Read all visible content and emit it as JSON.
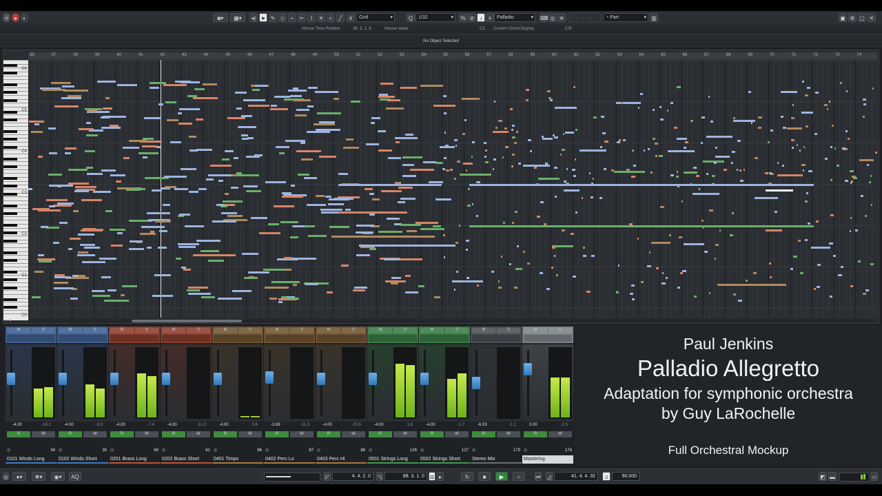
{
  "toolbar": {
    "grid_type": "Grid",
    "quantize": "1/32",
    "chord_track": "Palladio",
    "articulation": "Part"
  },
  "infobar": {
    "mouse_time_label": "Mouse Time Position",
    "mouse_time_value": "38. 3. 1. 8",
    "mouse_value_label": "Mouse Value",
    "mouse_value_value": "C2",
    "chord_label": "Current Chord Display",
    "chord_value": "C/E"
  },
  "status": "No Object Selected",
  "ruler": [
    "36",
    "37",
    "38",
    "39",
    "40",
    "41",
    "42",
    "43",
    "44",
    "45",
    "46",
    "47",
    "48",
    "49",
    "50",
    "51",
    "52",
    "53",
    "54",
    "55",
    "56",
    "57",
    "58",
    "59",
    "60",
    "61",
    "62",
    "63",
    "64",
    "65",
    "66",
    "67",
    "68",
    "69",
    "70",
    "71",
    "72",
    "73",
    "74"
  ],
  "keyboard_labels": [
    "C6",
    "C5",
    "C4",
    "C3",
    "C2",
    "C1",
    "C0"
  ],
  "colors": {
    "note_blue": "#9db5e0",
    "note_green": "#6bb06a",
    "note_orange": "#d98568",
    "note_brown": "#b08a5e",
    "note_white": "#f2f2f2",
    "meter": "#8cc63f",
    "fader": "#4a9ad8"
  },
  "mixer": [
    {
      "name": "0101 Winds Long",
      "num": "34",
      "vol": "-4.00",
      "peak": "-10.1",
      "color": "#3f5f8f",
      "bar": "#3e7ac4",
      "m1": 40,
      "m2": 42,
      "fader": 0.62
    },
    {
      "name": "0102 Winds Short",
      "num": "35",
      "vol": "-4.00",
      "peak": "-3.9",
      "color": "#3f5f8f",
      "bar": "#3e7ac4",
      "m1": 46,
      "m2": 40,
      "fader": 0.62
    },
    {
      "name": "0201 Brass Long",
      "num": "60",
      "vol": "-4.00",
      "peak": "-7.4",
      "color": "#8a3f2f",
      "bar": "#c0532f",
      "m1": 62,
      "m2": 58,
      "fader": 0.62
    },
    {
      "name": "0202 Brass Short",
      "num": "61",
      "vol": "-4.00",
      "peak": "-11.0",
      "color": "#8a3f2f",
      "bar": "#c0532f",
      "m1": 0,
      "m2": 0,
      "fader": 0.62
    },
    {
      "name": "0401 Timps",
      "num": "86",
      "vol": "-4.00",
      "peak": "0.8",
      "color": "#6f5433",
      "bar": "#a77b3e",
      "m1": 2,
      "m2": 2,
      "fader": 0.62
    },
    {
      "name": "0402 Perc Lo",
      "num": "87",
      "vol": "-3.69",
      "peak": "-11.3",
      "color": "#6f5433",
      "bar": "#a77b3e",
      "m1": 0,
      "m2": 0,
      "fader": 0.64
    },
    {
      "name": "0403 Perc Hi",
      "num": "88",
      "vol": "-4.00",
      "peak": "-20.6",
      "color": "#6f5433",
      "bar": "#a77b3e",
      "m1": 0,
      "m2": 0,
      "fader": 0.62
    },
    {
      "name": "0501 Strings Long",
      "num": "126",
      "vol": "-4.00",
      "peak": "1.9",
      "color": "#3a7a46",
      "bar": "#3f9a4f",
      "m1": 75,
      "m2": 73,
      "fader": 0.62
    },
    {
      "name": "0502 Strings Short",
      "num": "127",
      "vol": "-4.00",
      "peak": "-1.7",
      "color": "#3a7a46",
      "bar": "#3f9a4f",
      "m1": 54,
      "m2": 62,
      "fader": 0.62
    },
    {
      "name": "Stereo Mix",
      "num": "173",
      "vol": "-6.03",
      "peak": "-1.1",
      "color": "#4a4f55",
      "bar": "#6a7077",
      "m1": 0,
      "m2": 0,
      "fader": 0.55
    },
    {
      "name": "Mastering",
      "num": "174",
      "vol": "0.00",
      "peak": "-2.5",
      "color": "#7d8288",
      "bar": "#d6d9dc",
      "m1": 56,
      "m2": 56,
      "fader": 0.78
    }
  ],
  "title": {
    "composer": "Paul Jenkins",
    "piece": "Palladio Allegretto",
    "subtitle": "Adaptation for symphonic orchestra",
    "arranger": "by Guy LaRochelle",
    "mockup": "Full Orchestral Mockup"
  },
  "transport": {
    "left_locator": "4. 4. 2. 0",
    "position": "88. 3. 1. 0",
    "right_locator": "41. 4. 4. 32",
    "tempo": "90.000",
    "aq": "AQ"
  },
  "channel_buttons": {
    "mute": "M",
    "solo": "S",
    "read": "R",
    "write": "W"
  }
}
